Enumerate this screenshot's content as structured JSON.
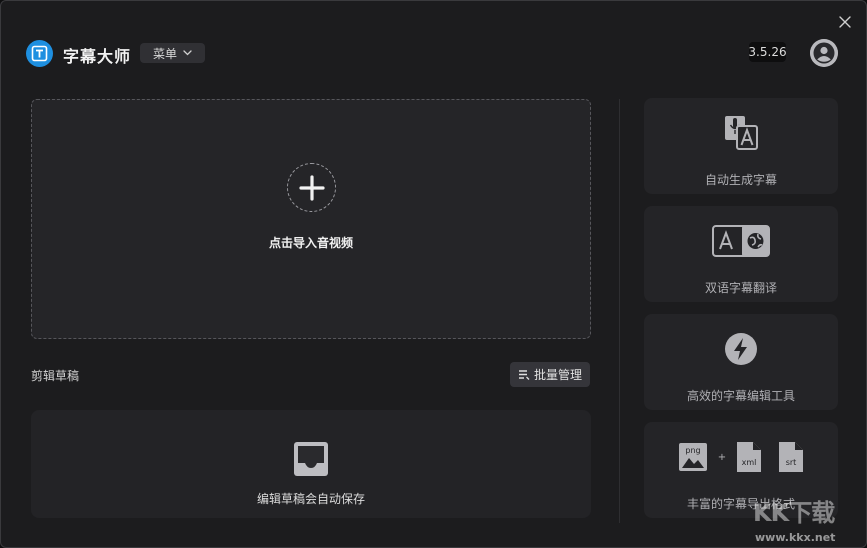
{
  "header": {
    "app_title": "字幕大师",
    "menu_label": "菜单",
    "version": "3.5.26"
  },
  "import": {
    "label": "点击导入音视频"
  },
  "drafts": {
    "title": "剪辑草稿",
    "batch_label": "批量管理",
    "empty_text": "编辑草稿会自动保存"
  },
  "features": [
    {
      "label": "自动生成字幕",
      "icon": "speech-to-text-icon"
    },
    {
      "label": "双语字幕翻译",
      "icon": "translate-icon"
    },
    {
      "label": "高效的字幕编辑工具",
      "icon": "lightning-icon"
    },
    {
      "label": "丰富的字幕导出格式",
      "icon": "export-formats-icon"
    }
  ],
  "formats": {
    "png": "png",
    "plus": "+",
    "xml": "xml",
    "srt": "srt"
  },
  "watermark": {
    "text": "KK下载",
    "url": "www.kkx.net"
  },
  "colors": {
    "accent": "#1e8fe0",
    "background": "#1c1c1e",
    "card": "#242427"
  }
}
